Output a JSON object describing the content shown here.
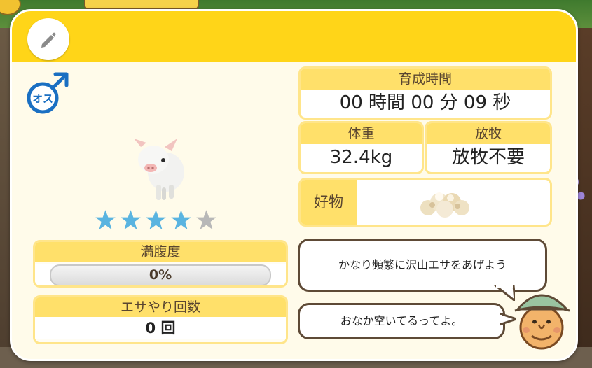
{
  "panel": {
    "edit_icon": "pencil-icon",
    "gender_icon": "male-symbol-icon",
    "gender_label": "オス"
  },
  "animal": {
    "image": "piglet",
    "rating": 4,
    "rating_max": 5
  },
  "fullness": {
    "label": "満腹度",
    "value": "0%",
    "fraction": 0
  },
  "feeding": {
    "label": "エサやり回数",
    "value": "0 回"
  },
  "growth_time": {
    "label": "育成時間",
    "value": "00 時間 00 分 09 秒"
  },
  "weight": {
    "label": "体重",
    "value": "32.4kg"
  },
  "grazing": {
    "label": "放牧",
    "value": "放牧不要"
  },
  "favorite": {
    "label": "好物",
    "icon": "feed-pile-icon"
  },
  "dialogue": {
    "line1": "かなり頻繁に沢山エサをあげよう",
    "line2": "おなか空いてるってよ。",
    "speaker": "farmer-avatar"
  },
  "colors": {
    "header": "#ffd518",
    "star_on": "#5ab4e0",
    "star_off": "#b8b8b8",
    "male": "#1a6fc2"
  }
}
